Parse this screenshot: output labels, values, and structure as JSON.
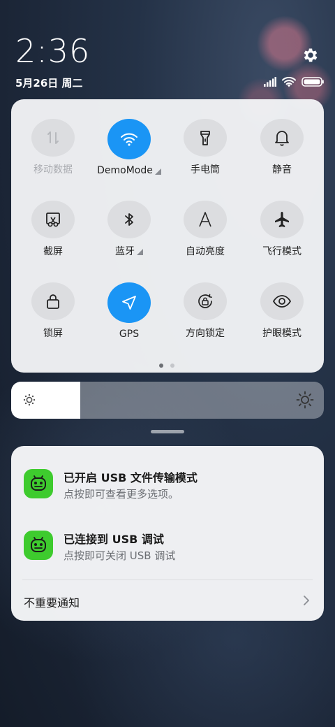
{
  "status_bar": {
    "time": "2:36",
    "date": "5月26日 周二",
    "icons": [
      "signal-icon",
      "wifi-icon",
      "battery-icon"
    ],
    "settings_icon": "gear-icon"
  },
  "quick_settings": {
    "tiles": [
      {
        "label": "移动数据",
        "icon": "mobile-data-icon",
        "active": false,
        "disabled": true,
        "expandable": false
      },
      {
        "label": "DemoMode",
        "icon": "wifi-icon",
        "active": true,
        "disabled": false,
        "expandable": true
      },
      {
        "label": "手电筒",
        "icon": "flashlight-icon",
        "active": false,
        "disabled": false,
        "expandable": false
      },
      {
        "label": "静音",
        "icon": "bell-icon",
        "active": false,
        "disabled": false,
        "expandable": false
      },
      {
        "label": "截屏",
        "icon": "screenshot-icon",
        "active": false,
        "disabled": false,
        "expandable": false
      },
      {
        "label": "蓝牙",
        "icon": "bluetooth-icon",
        "active": false,
        "disabled": false,
        "expandable": true
      },
      {
        "label": "自动亮度",
        "icon": "auto-brightness-icon",
        "active": false,
        "disabled": false,
        "expandable": false
      },
      {
        "label": "飞行模式",
        "icon": "airplane-icon",
        "active": false,
        "disabled": false,
        "expandable": false
      },
      {
        "label": "锁屏",
        "icon": "lock-icon",
        "active": false,
        "disabled": false,
        "expandable": false
      },
      {
        "label": "GPS",
        "icon": "location-arrow-icon",
        "active": true,
        "disabled": false,
        "expandable": false
      },
      {
        "label": "方向锁定",
        "icon": "rotation-lock-icon",
        "active": false,
        "disabled": false,
        "expandable": false
      },
      {
        "label": "护眼模式",
        "icon": "eye-icon",
        "active": false,
        "disabled": false,
        "expandable": false
      }
    ],
    "page_count": 2,
    "current_page": 1
  },
  "brightness": {
    "level": 0.22
  },
  "colors": {
    "accent": "#1a95f5",
    "app_icon": "#3ecb2e"
  },
  "notifications": [
    {
      "title": "已开启 USB 文件传输模式",
      "body": "点按即可查看更多选项。",
      "icon": "android-icon"
    },
    {
      "title": "已连接到 USB 调试",
      "body": "点按即可关闭 USB 调试",
      "icon": "android-icon"
    }
  ],
  "unimportant_notifications": {
    "label": "不重要通知"
  }
}
